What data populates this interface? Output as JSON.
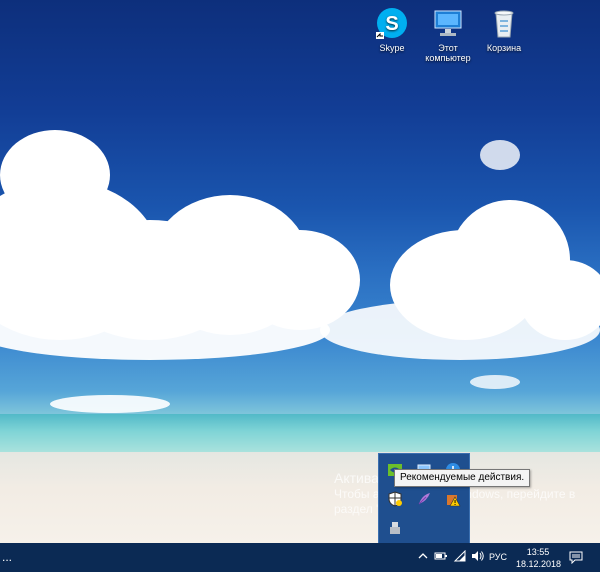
{
  "desktop_icons": [
    {
      "label": "Skype",
      "icon": "skype-icon"
    },
    {
      "label": "Этот\nкомпьютер",
      "icon": "computer-icon"
    },
    {
      "label": "Корзина",
      "icon": "recycle-bin-icon"
    }
  ],
  "activation_watermark": {
    "line1": "Активация Windows",
    "line2": "Чтобы активировать Windows, перейдите в",
    "line3": "раздел \"Параметры\"."
  },
  "tray_popup": {
    "tooltip": "Рекомендуемые действия.",
    "icons": [
      "nvidia-icon",
      "display-icon",
      "download-icon",
      "security-center-icon",
      "feather-icon",
      "warning-icon",
      "usb-icon"
    ]
  },
  "taskbar": {
    "left_dots": "...",
    "show_hidden_icon": "chevron-up-icon",
    "language": "РУС",
    "time": "13:55",
    "date": "18.12.2018",
    "notification_icon": "action-center-icon"
  },
  "colors": {
    "taskbar": "#0b2a54",
    "tray_popup": "#1f4f8f",
    "sky_top": "#0d2f7c",
    "sea": "#7fd4d6"
  }
}
